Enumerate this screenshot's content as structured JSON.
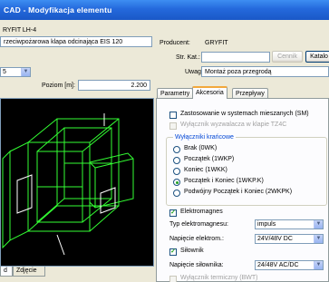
{
  "window": {
    "title": "CAD - Modyfikacja elementu"
  },
  "left": {
    "name_value": "RYFIT LH-4",
    "description_value": "rzeciwpożarowa klapa odcinająca EIS 120",
    "dropdown_value": "5",
    "position_label": "Poziom [m]:",
    "position_value": "2.200"
  },
  "right": {
    "producer_label": "Producent:",
    "producer_value": "GRYFIT",
    "catalog_label": "Str. Kat.:",
    "catalog_value": "",
    "catalog_buttons": [
      "Cennik",
      "Katalo"
    ],
    "notes_label": "Uwagi:",
    "notes_value": "Montaż poza przegrodą"
  },
  "tabs": [
    {
      "label": "Parametry",
      "active": false
    },
    {
      "label": "Akcesoria",
      "active": true
    },
    {
      "label": "Przepływy",
      "active": false
    }
  ],
  "accessories": {
    "use_in_mixed_systems": {
      "label": "Zastosowanie w systemach mieszanych (SM)",
      "checked": false
    },
    "faded_option": {
      "label": "Wyłącznik wyzwalacza w klapie TZ4C",
      "checked": false,
      "disabled": true
    },
    "limit_switches": {
      "title": "Wyłączniki krańcowe",
      "options": [
        {
          "label": "Brak (0WK)",
          "selected": false
        },
        {
          "label": "Początek (1WKP)",
          "selected": false
        },
        {
          "label": "Koniec (1WKK)",
          "selected": false
        },
        {
          "label": "Początek i Koniec (1WKP.K)",
          "selected": true
        },
        {
          "label": "Podwójny Początek i Koniec (2WKPK)",
          "selected": false
        }
      ]
    },
    "electromagnet": {
      "label": "Elektromagnes",
      "checked": true
    },
    "electromagnet_type": {
      "label": "Typ elektromagnesu:",
      "value": "impuls"
    },
    "electromagnet_voltage": {
      "label": "Napięcie elektrom.:",
      "value": "24V/48V DC"
    },
    "actuator": {
      "label": "Siłownik",
      "checked": true
    },
    "actuator_voltage": {
      "label": "Napięcie siłownika:",
      "value": "24/48V AC/DC"
    },
    "bottom_faded_option": {
      "label": "Wyłącznik termiczny (BWT)",
      "disabled": true
    }
  },
  "bottom_tabs": [
    "d",
    "Zdjęcie"
  ]
}
